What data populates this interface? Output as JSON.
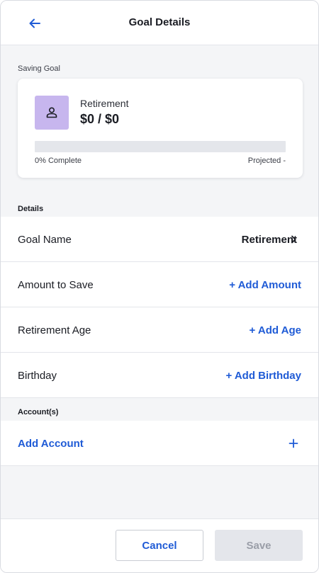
{
  "header": {
    "title": "Goal Details",
    "back_icon": "arrow-left-icon"
  },
  "saving_goal": {
    "section_label": "Saving Goal",
    "name": "Retirement",
    "amount": "$0 / $0",
    "avatar_icon": "person-icon",
    "avatar_color": "#c7b6ee",
    "progress_percent": 0,
    "progress_label": "0% Complete",
    "projected_label": "Projected -"
  },
  "details": {
    "section_label": "Details",
    "rows": [
      {
        "label": "Goal Name",
        "value": "Retirement"
      },
      {
        "label": "Amount to Save",
        "value": "+ Add Amount"
      },
      {
        "label": "Retirement Age",
        "value": "+ Add Age"
      },
      {
        "label": "Birthday",
        "value": "+ Add Birthday"
      }
    ]
  },
  "accounts": {
    "section_label": "Account(s)",
    "add_label": "Add Account"
  },
  "footer": {
    "cancel_label": "Cancel",
    "save_label": "Save"
  },
  "colors": {
    "accent": "#1f5bd6",
    "disabled_bg": "#e4e6eb"
  }
}
